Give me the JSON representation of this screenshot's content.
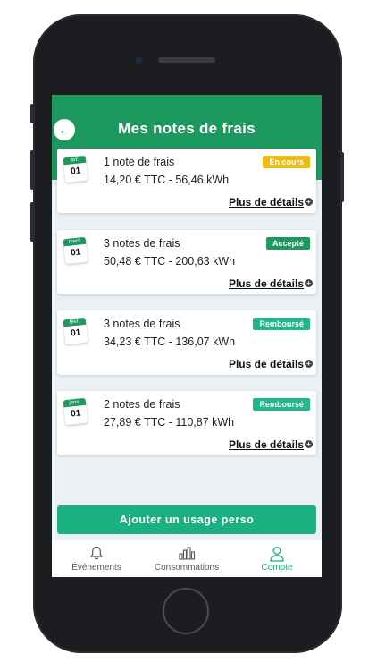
{
  "header": {
    "back_icon": "arrow-left-icon",
    "title": "Mes notes de frais"
  },
  "colors": {
    "brand": "#1d9960",
    "accent": "#1bb07f",
    "pending": "#e9bd14",
    "accepted": "#1d9960",
    "refunded": "#20b58a"
  },
  "expenses": [
    {
      "month": "avr.",
      "day": "01",
      "count": "1 note de frais",
      "amount": "14,20 € TTC - 56,46 kWh",
      "status": "En cours",
      "details": "Plus de détails"
    },
    {
      "month": "mars",
      "day": "01",
      "count": "3 notes de frais",
      "amount": "50,48 € TTC - 200,63 kWh",
      "status": "Accepté",
      "details": "Plus de détails"
    },
    {
      "month": "févr.",
      "day": "01",
      "count": "3 notes de frais",
      "amount": "34,23 € TTC - 136,07 kWh",
      "status": "Remboursé",
      "details": "Plus de détails"
    },
    {
      "month": "janv.",
      "day": "01",
      "count": "2 notes de frais",
      "amount": "27,89 € TTC - 110,87 kWh",
      "status": "Remboursé",
      "details": "Plus de détails"
    }
  ],
  "add_button": "Ajouter un usage perso",
  "tabbar": {
    "items": [
      {
        "label": "Événements",
        "icon": "bell-icon"
      },
      {
        "label": "Consommations",
        "icon": "bar-chart-icon"
      },
      {
        "label": "Compte",
        "icon": "user-icon",
        "active": true
      }
    ]
  }
}
